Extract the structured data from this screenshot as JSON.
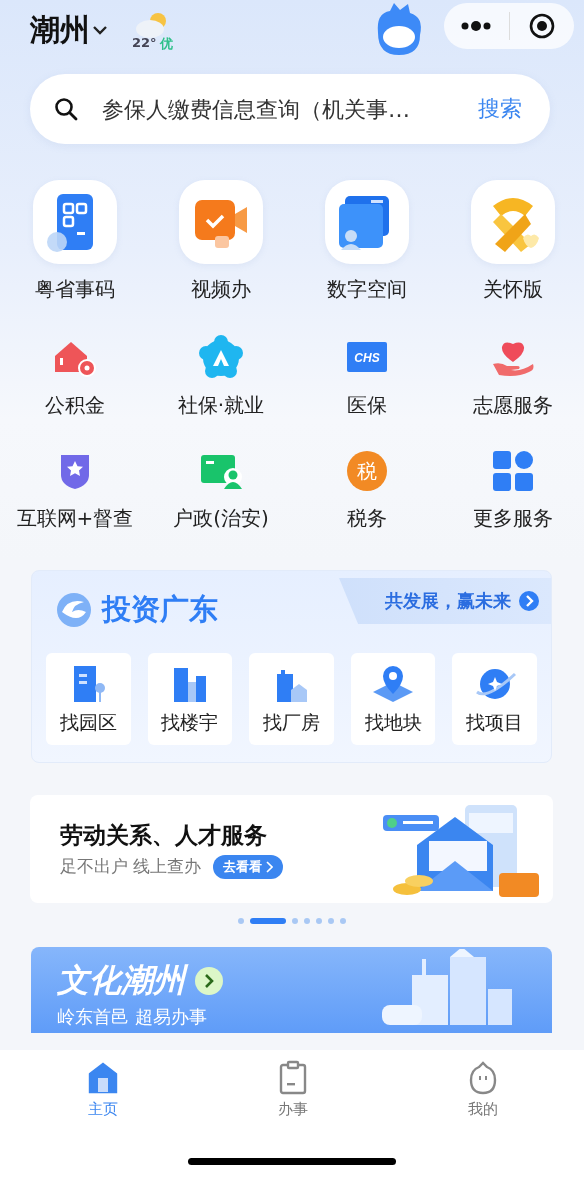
{
  "header": {
    "city": "潮州",
    "temperature": "22°",
    "air_quality": "优"
  },
  "search": {
    "placeholder": "参保人缴费信息查询（机关事…",
    "button": "搜索"
  },
  "featured_services": [
    {
      "label": "粤省事码"
    },
    {
      "label": "视频办"
    },
    {
      "label": "数字空间"
    },
    {
      "label": "关怀版"
    }
  ],
  "services": [
    {
      "label": "公积金"
    },
    {
      "label": "社保·就业"
    },
    {
      "label": "医保",
      "badge": "CHS"
    },
    {
      "label": "志愿服务"
    },
    {
      "label": "互联网+督查"
    },
    {
      "label": "户政(治安)"
    },
    {
      "label": "税务",
      "badge": "税"
    },
    {
      "label": "更多服务"
    }
  ],
  "invest": {
    "title": "投资广东",
    "slogan": "共发展，赢未来",
    "items": [
      {
        "label": "找园区"
      },
      {
        "label": "找楼宇"
      },
      {
        "label": "找厂房"
      },
      {
        "label": "找地块"
      },
      {
        "label": "找项目"
      }
    ]
  },
  "banner": {
    "title": "劳动关系、人才服务",
    "subtitle": "足不出户 线上查办",
    "button": "去看看"
  },
  "carousel_dots": [
    {
      "selected": false
    },
    {
      "selected": true
    },
    {
      "selected": false
    },
    {
      "selected": false
    },
    {
      "selected": false
    },
    {
      "selected": false
    },
    {
      "selected": false
    }
  ],
  "culture": {
    "title": "文化潮州",
    "subtitle": "岭东首邑 超易办事"
  },
  "tab_bar": [
    {
      "label": "主页",
      "selected": true
    },
    {
      "label": "办事",
      "selected": false
    },
    {
      "label": "我的",
      "selected": false
    }
  ]
}
